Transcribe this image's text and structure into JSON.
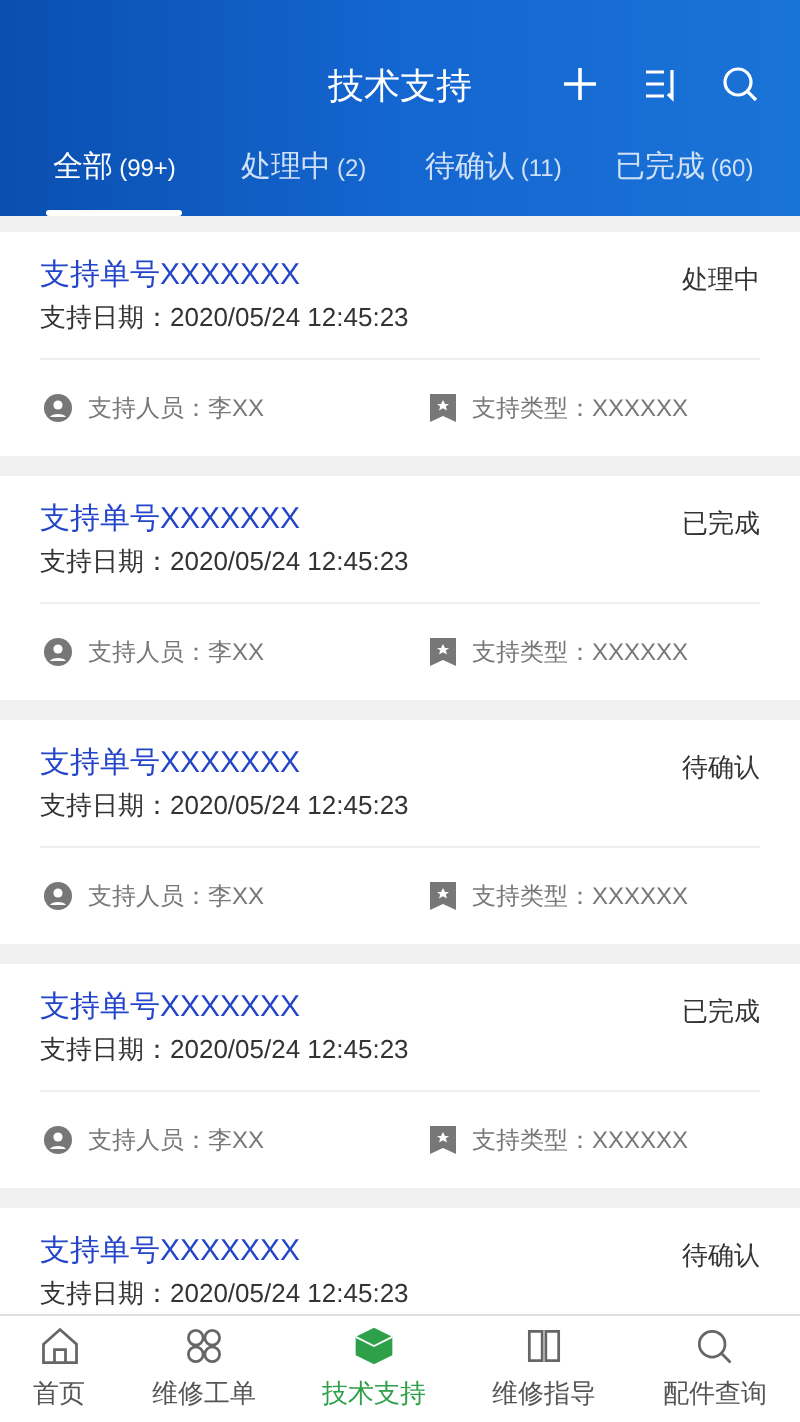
{
  "header": {
    "title": "技术支持"
  },
  "tabs": [
    {
      "label": "全部",
      "count": "(99+)",
      "selected": true
    },
    {
      "label": "处理中",
      "count": "(2)",
      "selected": false
    },
    {
      "label": "待确认",
      "count": "(11)",
      "selected": false
    },
    {
      "label": "已完成",
      "count": "(60)",
      "selected": false
    }
  ],
  "tickets": [
    {
      "title": "支持单号XXXXXXX",
      "date": "支持日期：2020/05/24 12:45:23",
      "status": "处理中",
      "staff": "支持人员：李XX",
      "type": "支持类型：XXXXXX"
    },
    {
      "title": "支持单号XXXXXXX",
      "date": "支持日期：2020/05/24 12:45:23",
      "status": "已完成",
      "staff": "支持人员：李XX",
      "type": "支持类型：XXXXXX"
    },
    {
      "title": "支持单号XXXXXXX",
      "date": "支持日期：2020/05/24 12:45:23",
      "status": "待确认",
      "staff": "支持人员：李XX",
      "type": "支持类型：XXXXXX"
    },
    {
      "title": "支持单号XXXXXXX",
      "date": "支持日期：2020/05/24 12:45:23",
      "status": "已完成",
      "staff": "支持人员：李XX",
      "type": "支持类型：XXXXXX"
    },
    {
      "title": "支持单号XXXXXXX",
      "date": "支持日期：2020/05/24 12:45:23",
      "status": "待确认"
    }
  ],
  "bottom_nav": [
    {
      "label": "首页",
      "kind": "home",
      "selected": false
    },
    {
      "label": "维修工单",
      "kind": "grid",
      "selected": false
    },
    {
      "label": "技术支持",
      "kind": "cube",
      "selected": true
    },
    {
      "label": "维修指导",
      "kind": "book",
      "selected": false
    },
    {
      "label": "配件查询",
      "kind": "search",
      "selected": false
    }
  ]
}
